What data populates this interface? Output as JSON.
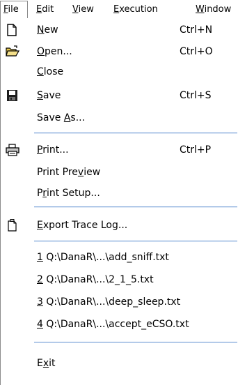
{
  "menubar": {
    "items": [
      {
        "label": "File",
        "mnemonic_index": 0,
        "active": true
      },
      {
        "label": "Edit",
        "mnemonic_index": 0
      },
      {
        "label": "View",
        "mnemonic_index": 0
      },
      {
        "label": "Execution",
        "mnemonic_index": 0
      },
      {
        "label": "Window",
        "mnemonic_index": 0
      }
    ]
  },
  "file_menu": {
    "items": [
      {
        "label": "New",
        "mnemonic_index": 0,
        "shortcut": "Ctrl+N",
        "icon": "new-document-icon"
      },
      {
        "label": "Open...",
        "mnemonic_index": 0,
        "shortcut": "Ctrl+O",
        "icon": "open-folder-icon"
      },
      {
        "label": "Close",
        "mnemonic_index": 0
      },
      {
        "label": "Save",
        "mnemonic_index": 0,
        "shortcut": "Ctrl+S",
        "icon": "save-disk-icon"
      },
      {
        "label": "Save As...",
        "mnemonic_index": 5
      },
      {
        "label": "Print...",
        "mnemonic_index": 0,
        "shortcut": "Ctrl+P",
        "icon": "printer-icon"
      },
      {
        "label": "Print Preview",
        "mnemonic_index": 9
      },
      {
        "label": "Print Setup...",
        "mnemonic_index": 1
      },
      {
        "label": "Export Trace Log...",
        "mnemonic_index": 0,
        "icon": "export-document-icon"
      },
      {
        "label": "1 Q:\\DanaR\\...\\add_sniff.txt",
        "mnemonic_index": 0
      },
      {
        "label": "2 Q:\\DanaR\\...\\2_1_5.txt",
        "mnemonic_index": 0
      },
      {
        "label": "3 Q:\\DanaR\\...\\deep_sleep.txt",
        "mnemonic_index": 0
      },
      {
        "label": "4 Q:\\DanaR\\...\\accept_eCSO.txt",
        "mnemonic_index": 0
      },
      {
        "label": "Exit",
        "mnemonic_index": 1
      }
    ]
  },
  "colors": {
    "separator": "#7aa2d8",
    "frame": "#8a8a8a",
    "background": "#ffffff"
  }
}
